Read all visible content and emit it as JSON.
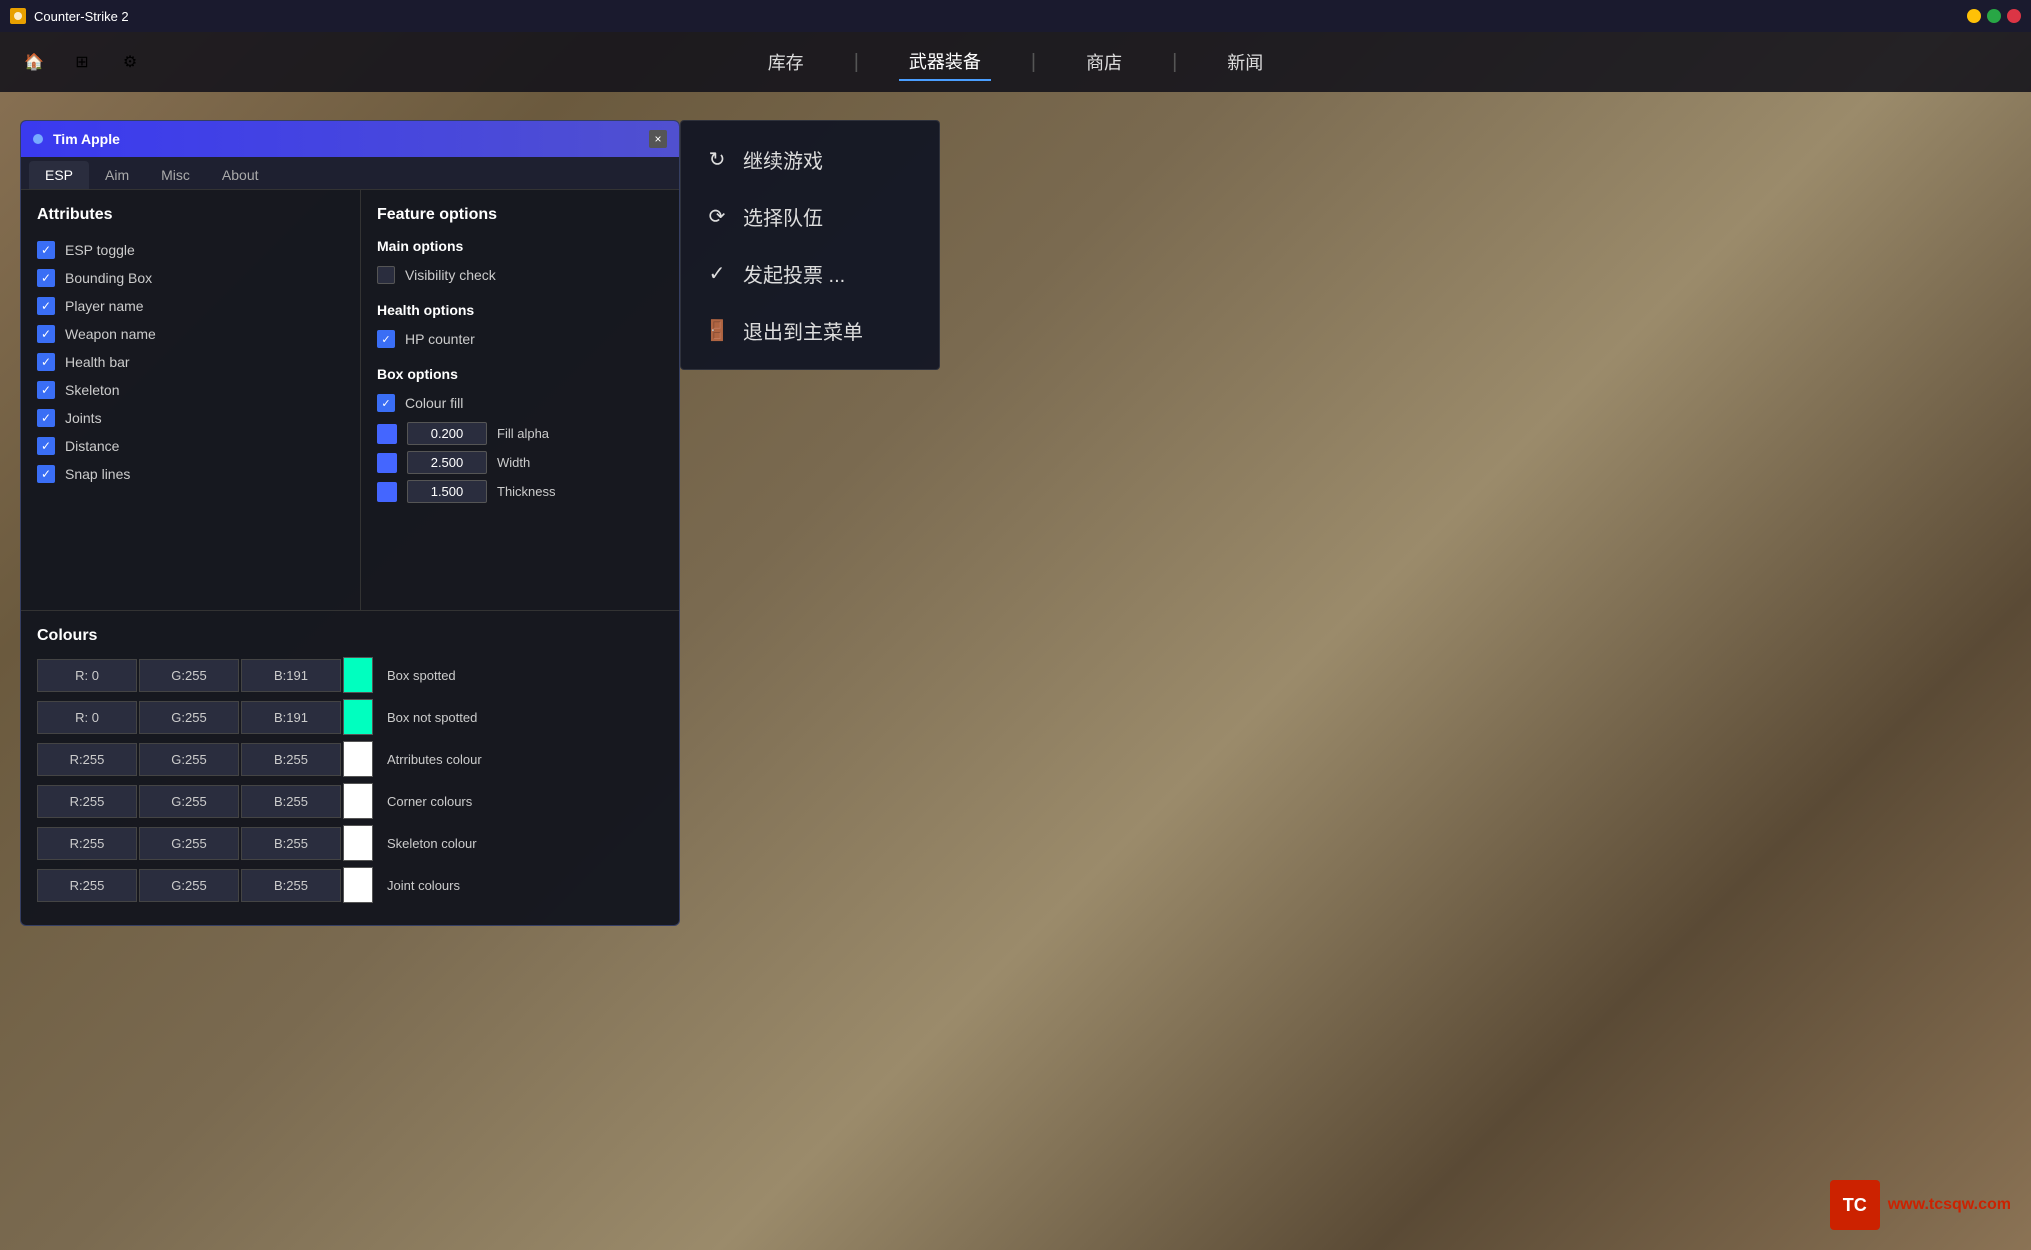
{
  "titlebar": {
    "title": "Counter-Strike 2",
    "close_label": "×"
  },
  "topnav": {
    "icon1": "🏠",
    "icon2": "⊞",
    "icon3": "⚙",
    "items": [
      {
        "label": "库存",
        "active": false
      },
      {
        "label": "武器装备",
        "active": true
      },
      {
        "label": "商店",
        "active": false
      },
      {
        "label": "新闻",
        "active": false
      }
    ]
  },
  "game_menu": {
    "items": [
      {
        "icon": "↻",
        "label": "继续游戏"
      },
      {
        "icon": "⟳",
        "label": "选择队伍"
      },
      {
        "icon": "✓",
        "label": "发起投票 ..."
      },
      {
        "icon": "🚪",
        "label": "退出到主菜单"
      }
    ]
  },
  "esp_panel": {
    "title": "Tim Apple",
    "close": "×",
    "tabs": [
      "ESP",
      "Aim",
      "Misc",
      "About"
    ],
    "active_tab": "ESP",
    "attributes": {
      "title": "Attributes",
      "items": [
        {
          "label": "ESP toggle",
          "checked": true
        },
        {
          "label": "Bounding Box",
          "checked": true
        },
        {
          "label": "Player name",
          "checked": true
        },
        {
          "label": "Weapon name",
          "checked": true
        },
        {
          "label": "Health bar",
          "checked": true
        },
        {
          "label": "Skeleton",
          "checked": true
        },
        {
          "label": "Joints",
          "checked": true
        },
        {
          "label": "Distance",
          "checked": true
        },
        {
          "label": "Snap lines",
          "checked": true
        }
      ]
    },
    "feature_options": {
      "title": "Feature options",
      "main_options": {
        "title": "Main options",
        "items": [
          {
            "label": "Visibility check",
            "checked": false
          }
        ]
      },
      "health_options": {
        "title": "Health options",
        "items": [
          {
            "label": "HP counter",
            "checked": true
          }
        ]
      },
      "box_options": {
        "title": "Box options",
        "items": [
          {
            "label": "Colour fill",
            "checked": true
          }
        ],
        "sliders": [
          {
            "color": "#4466ff",
            "value": "0.200",
            "label": "Fill alpha"
          },
          {
            "color": "#4466ff",
            "value": "2.500",
            "label": "Width"
          },
          {
            "color": "#4466ff",
            "value": "1.500",
            "label": "Thickness"
          }
        ]
      }
    }
  },
  "colours": {
    "title": "Colours",
    "rows": [
      {
        "r": "R: 0",
        "g": "G:255",
        "b": "B:191",
        "swatch": "#00ffbf",
        "label": "Box spotted"
      },
      {
        "r": "R: 0",
        "g": "G:255",
        "b": "B:191",
        "swatch": "#00ffbf",
        "label": "Box not spotted"
      },
      {
        "r": "R:255",
        "g": "G:255",
        "b": "B:255",
        "swatch": "#ffffff",
        "label": "Atrributes colour"
      },
      {
        "r": "R:255",
        "g": "G:255",
        "b": "B:255",
        "swatch": "#ffffff",
        "label": "Corner colours"
      },
      {
        "r": "R:255",
        "g": "G:255",
        "b": "B:255",
        "swatch": "#ffffff",
        "label": "Skeleton colour"
      },
      {
        "r": "R:255",
        "g": "G:255",
        "b": "B:255",
        "swatch": "#ffffff",
        "label": "Joint colours"
      }
    ]
  },
  "watermark": {
    "logo": "TC",
    "text": "www.tcsqw.com"
  }
}
